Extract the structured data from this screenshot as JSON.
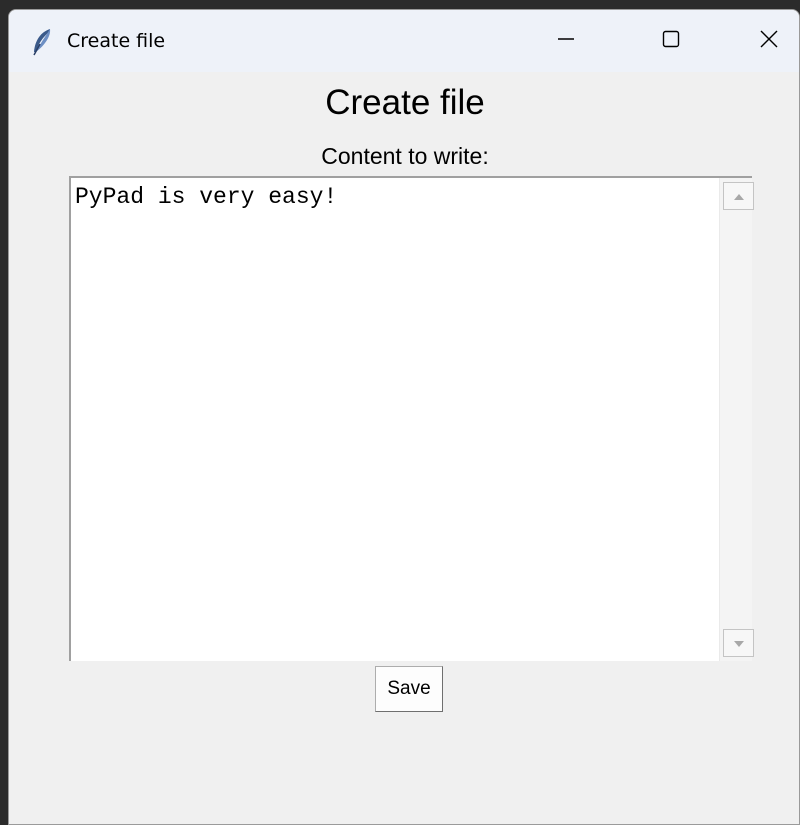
{
  "window": {
    "title": "Create file",
    "controls": {
      "minimize": "minimize-icon",
      "maximize": "maximize-icon",
      "close": "close-icon"
    }
  },
  "form": {
    "heading": "Create file",
    "content_label": "Content to write:",
    "content_value": "PyPad is very easy!",
    "save_label": "Save"
  },
  "icons": {
    "app": "feather-icon",
    "scroll_up": "scroll-up-arrow-icon",
    "scroll_down": "scroll-down-arrow-icon"
  },
  "colors": {
    "window_bg": "#f0f0f0",
    "titlebar_bg": "#eef2f9",
    "text_area_bg": "#ffffff"
  }
}
